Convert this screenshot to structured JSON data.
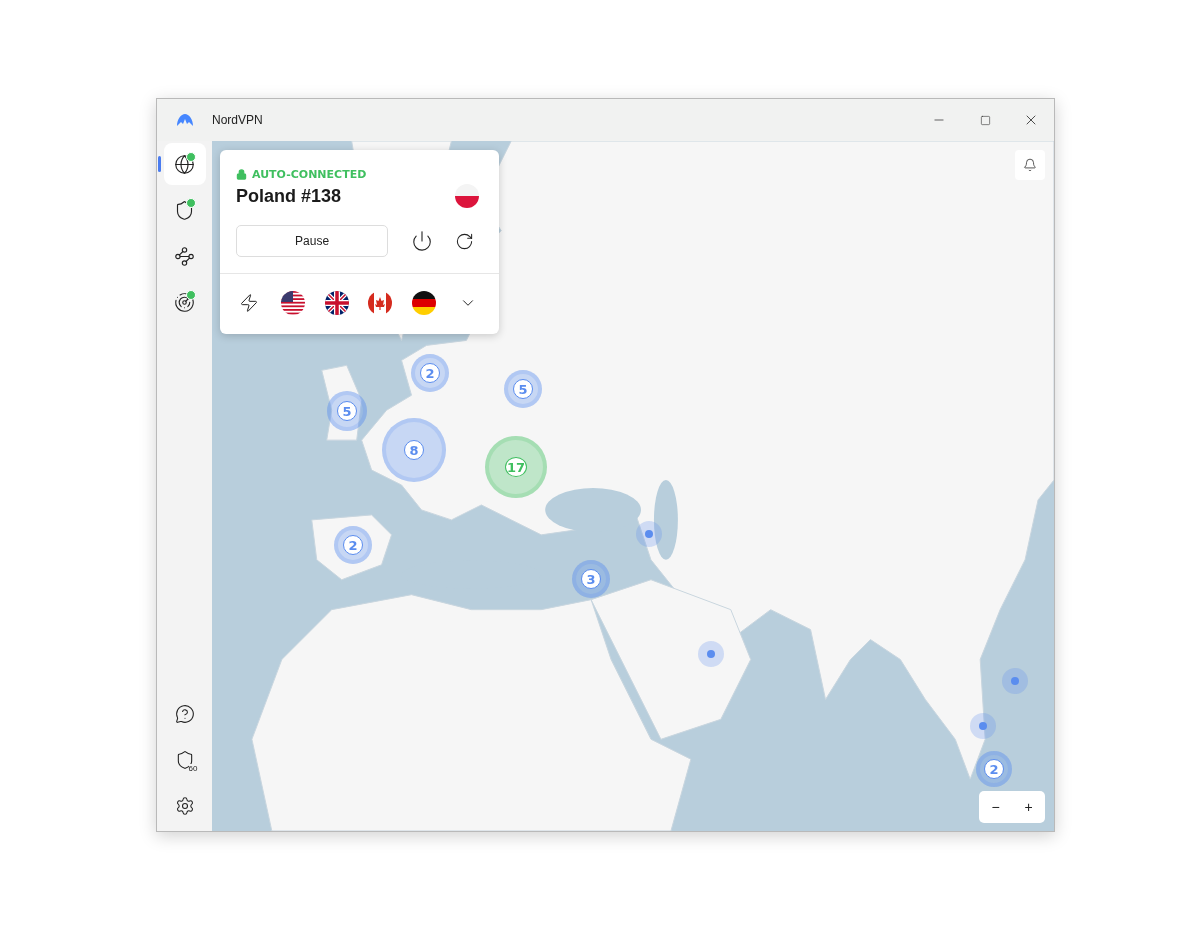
{
  "window": {
    "title": "NordVPN"
  },
  "sidebar": {
    "items": [
      {
        "kind": "globe",
        "selected": true,
        "indicator": true
      },
      {
        "kind": "shield",
        "selected": false,
        "indicator": true
      },
      {
        "kind": "mesh",
        "selected": false,
        "indicator": false
      },
      {
        "kind": "radar",
        "selected": false,
        "indicator": true
      }
    ],
    "bottom_items": [
      {
        "kind": "help"
      },
      {
        "kind": "shield-badge",
        "badge": "60"
      },
      {
        "kind": "settings"
      }
    ]
  },
  "connection": {
    "status": "AUTO-CONNECTED",
    "server": "Poland #138",
    "pause_button": "Pause"
  },
  "quick_connect": [
    {
      "kind": "fastest"
    },
    {
      "kind": "us"
    },
    {
      "kind": "uk"
    },
    {
      "kind": "ca"
    },
    {
      "kind": "de"
    },
    {
      "kind": "more"
    }
  ],
  "map": {
    "markers": [
      {
        "kind": "cluster",
        "count": "2",
        "color": "#5b8def"
      },
      {
        "kind": "cluster",
        "count": "5",
        "color": "#5b8def"
      },
      {
        "kind": "cluster",
        "count": "5",
        "color": "#5b8def"
      },
      {
        "kind": "cluster",
        "count": "8",
        "color": "#5b8def"
      },
      {
        "kind": "cluster",
        "count": "17",
        "color": "#3fbf5f"
      },
      {
        "kind": "cluster",
        "count": "2",
        "color": "#5b8def"
      },
      {
        "kind": "dot",
        "color": "#5b8def"
      },
      {
        "kind": "cluster",
        "count": "3",
        "color": "#5b8def"
      },
      {
        "kind": "dot",
        "color": "#5b8def"
      },
      {
        "kind": "dot",
        "color": "#5b8def"
      },
      {
        "kind": "dot",
        "color": "#5b8def"
      },
      {
        "kind": "cluster",
        "count": "2",
        "color": "#5b8def"
      }
    ],
    "zoom_out": "−",
    "zoom_in": "+"
  }
}
